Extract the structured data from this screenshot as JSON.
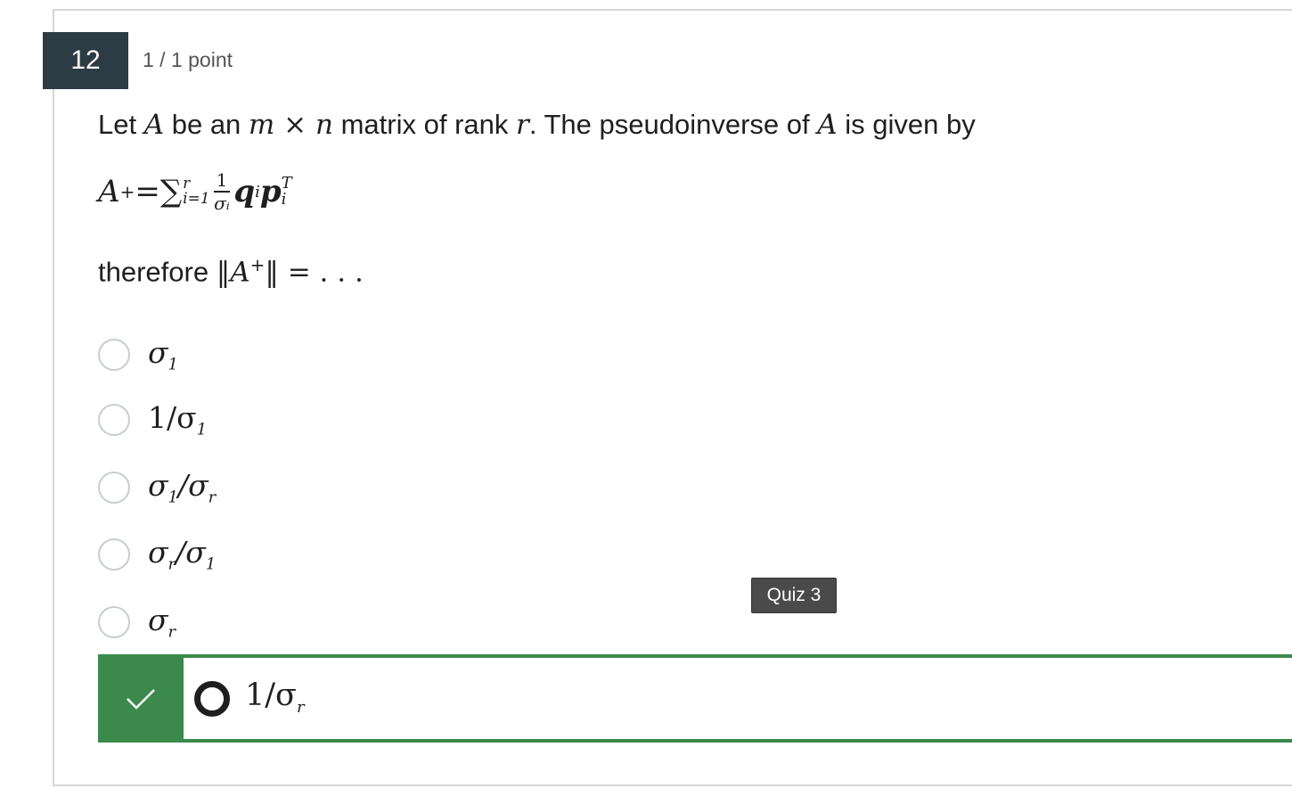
{
  "question": {
    "number": "12",
    "points": "1 / 1 point",
    "text_parts": {
      "p1": "Let ",
      "A": "A",
      "p2": " be an ",
      "m": "m",
      "times": " × ",
      "n": "n",
      "p3": " matrix of rank ",
      "r": "r",
      "p4": ". The pseudoinverse of ",
      "A2": "A",
      "p5": " is given by"
    },
    "formula": {
      "lhs": "A",
      "lhs_sup": "+",
      "eq": " = ",
      "sum": "∑",
      "sum_upper": "r",
      "sum_lower": "i=1",
      "frac_num": "1",
      "frac_den": "σᵢ",
      "q": "q",
      "q_sub": "i",
      "p": "p",
      "p_sup": "T",
      "p_sub": "i"
    },
    "therefore": {
      "word": "therefore ",
      "expr_open": "‖A",
      "expr_sup": "+",
      "expr_close": "‖",
      "rest": " = . . ."
    }
  },
  "options": [
    {
      "main": "σ",
      "sub": "1",
      "tail": ""
    },
    {
      "main": "1/σ",
      "sub": "1",
      "tail": ""
    },
    {
      "main": "σ",
      "sub": "1",
      "tail": "/σ",
      "sub2": "r"
    },
    {
      "main": "σ",
      "sub": "r",
      "tail": "/σ",
      "sub2": "1"
    },
    {
      "main": "σ",
      "sub": "r",
      "tail": ""
    }
  ],
  "correct_option": {
    "main": "1/σ",
    "sub": "r"
  },
  "tooltip": "Quiz 3",
  "colors": {
    "correct_green": "#3b8a4c",
    "number_bg": "#2d3b45"
  },
  "icons": {
    "correct": "checkmark-icon"
  }
}
